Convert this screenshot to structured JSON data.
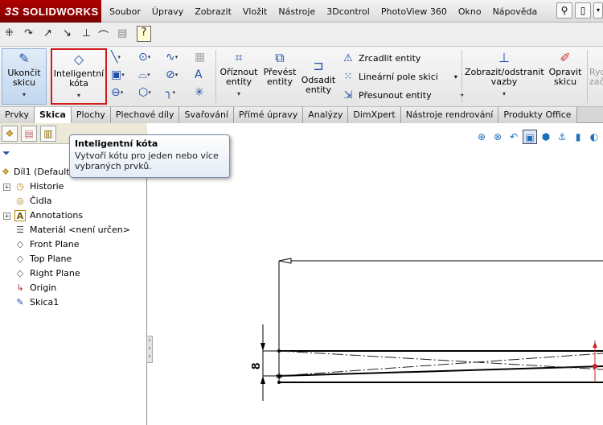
{
  "app": {
    "logo_ds": "3S",
    "logo_text": "SOLIDWORKS"
  },
  "menu": [
    "Soubor",
    "Úpravy",
    "Zobrazit",
    "Vložit",
    "Nástroje",
    "3Dcontrol",
    "PhotoView 360",
    "Okno",
    "Nápověda"
  ],
  "ribbon": {
    "finish_sketch": {
      "line1": "Ukončit",
      "line2": "skicu"
    },
    "smart_dimension": {
      "line1": "Inteligentní",
      "line2": "kóta"
    },
    "trim": {
      "line1": "Oříznout",
      "line2": "entity"
    },
    "convert": {
      "line1": "Převést",
      "line2": "entity"
    },
    "offset": {
      "line1": "Odsadit",
      "line2": "entity"
    },
    "mirror": "Zrcadlit entity",
    "linear_pattern": "Lineární pole skici",
    "move": "Přesunout entity",
    "display_relations": {
      "line1": "Zobrazit/odstranit",
      "line2": "vazby"
    },
    "repair": {
      "line1": "Opravit",
      "line2": "skicu"
    },
    "partial": {
      "line1": "Rychl",
      "line2": "zač"
    }
  },
  "tabs": [
    {
      "label": "Prvky",
      "active": false
    },
    {
      "label": "Skica",
      "active": true
    },
    {
      "label": "Plochy",
      "active": false
    },
    {
      "label": "Plechové díly",
      "active": false
    },
    {
      "label": "Svařování",
      "active": false
    },
    {
      "label": "Přímé úpravy",
      "active": false
    },
    {
      "label": "Analýzy",
      "active": false
    },
    {
      "label": "DimXpert",
      "active": false
    },
    {
      "label": "Nástroje rendrování",
      "active": false
    },
    {
      "label": "Produkty Office",
      "active": false
    }
  ],
  "tooltip": {
    "title": "Inteligentní kóta",
    "line1": "Vytvoří kótu pro jeden nebo více",
    "line2": "vybraných prvků."
  },
  "tree": {
    "root": "Díl1  (Default",
    "items": [
      "Historie",
      "Čidla",
      "Annotations",
      "Materiál <není určen>",
      "Front Plane",
      "Top Plane",
      "Right Plane",
      "Origin",
      "Skica1"
    ]
  },
  "sketch": {
    "dimension_value": "8"
  },
  "colors": {
    "accent": "#1f4fa8",
    "highlight_border": "#d21c1c",
    "logo_bg": "#9a0000"
  }
}
